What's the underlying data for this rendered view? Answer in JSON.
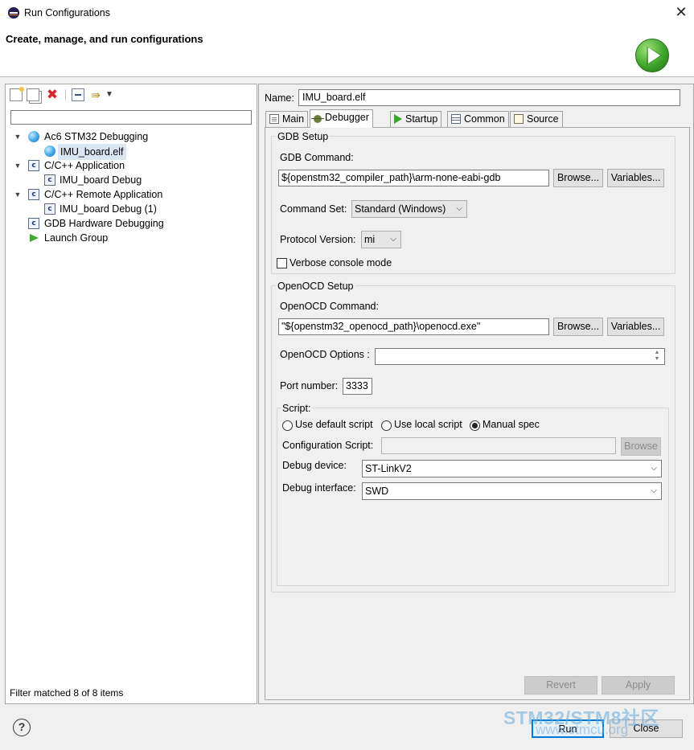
{
  "window": {
    "title": "Run Configurations",
    "close_glyph": "✕"
  },
  "header": {
    "title": "Create, manage, and run configurations"
  },
  "left": {
    "filter_value": "",
    "tree": [
      {
        "label": "Ac6 STM32 Debugging",
        "icon": "globe-icon",
        "expanded": true
      },
      {
        "label": "IMU_board.elf",
        "icon": "globe-icon",
        "selected": true
      },
      {
        "label": "C/C++ Application",
        "icon": "c-config-icon",
        "expanded": true
      },
      {
        "label": "IMU_board Debug",
        "icon": "c-config-icon"
      },
      {
        "label": "C/C++ Remote Application",
        "icon": "c-config-icon",
        "expanded": true
      },
      {
        "label": "IMU_board Debug (1)",
        "icon": "c-config-icon"
      },
      {
        "label": "GDB Hardware Debugging",
        "icon": "c-config-icon"
      },
      {
        "label": "Launch Group",
        "icon": "launch-group-icon"
      }
    ],
    "status": "Filter matched 8 of 8 items"
  },
  "right": {
    "name_label": "Name:",
    "name_value": "IMU_board.elf",
    "tabs": [
      {
        "label": "Main",
        "icon": "main-tab-icon"
      },
      {
        "label": "Debugger",
        "icon": "bug-icon",
        "active": true
      },
      {
        "label": "Startup",
        "icon": "play-icon"
      },
      {
        "label": "Common",
        "icon": "common-tab-icon"
      },
      {
        "label": "Source",
        "icon": "source-icon"
      }
    ],
    "gdb": {
      "legend": "GDB Setup",
      "command_label": "GDB Command:",
      "command_value": "${openstm32_compiler_path}\\arm-none-eabi-gdb",
      "browse": "Browse...",
      "variables": "Variables...",
      "command_set_label": "Command Set:",
      "command_set_value": "Standard (Windows)",
      "protocol_label": "Protocol Version:",
      "protocol_value": "mi",
      "verbose_label": "Verbose console mode"
    },
    "openocd": {
      "legend": "OpenOCD Setup",
      "command_label": "OpenOCD Command:",
      "command_value": "\"${openstm32_openocd_path}\\openocd.exe\"",
      "browse": "Browse...",
      "variables": "Variables...",
      "options_label": "OpenOCD Options :",
      "options_value": "",
      "port_label": "Port number:",
      "port_value": "3333",
      "script": {
        "legend": "Script:",
        "radio_default": "Use default script",
        "radio_local": "Use local script",
        "radio_manual": "Manual spec",
        "config_label": "Configuration Script:",
        "config_value": "",
        "config_browse": "Browse",
        "device_label": "Debug device:",
        "device_value": "ST-LinkV2",
        "interface_label": "Debug interface:",
        "interface_value": "SWD"
      }
    },
    "revert": "Revert",
    "apply": "Apply"
  },
  "footer": {
    "help_glyph": "?",
    "run": "Run",
    "close": "Close"
  },
  "watermark": {
    "line1": "STM32/STM8社区",
    "line2": "www.stmcu.org"
  }
}
